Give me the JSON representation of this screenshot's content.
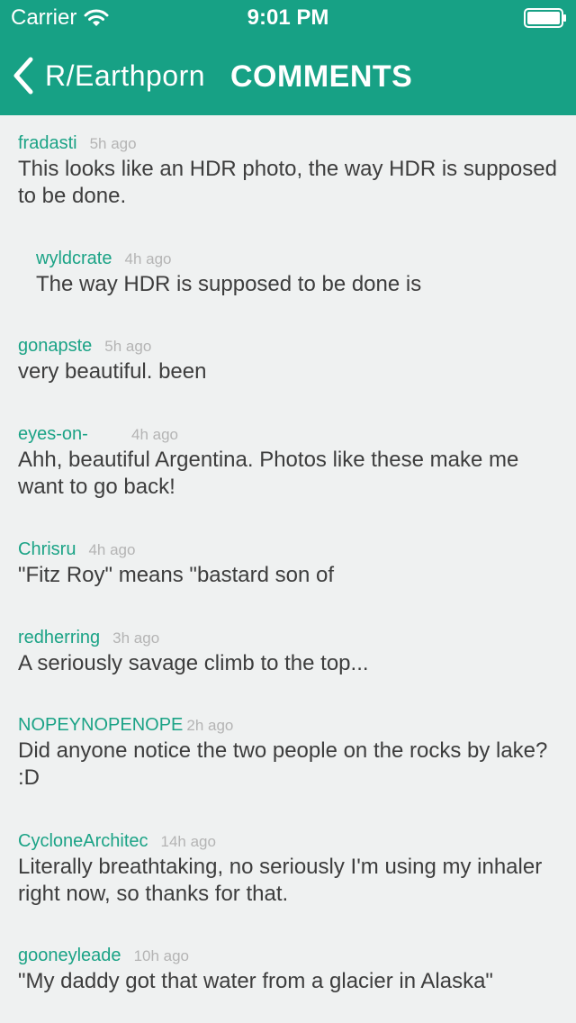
{
  "status": {
    "carrier": "Carrier",
    "time": "9:01 PM",
    "icons": [
      "wifi-icon",
      "battery-icon"
    ]
  },
  "nav": {
    "back_label": "R/Earthporn",
    "back_icon": "chevron-left-icon",
    "title": "COMMENTS"
  },
  "colors": {
    "header_bg": "#17a185",
    "author": "#1ba386",
    "timestamp": "#b4b4b4",
    "background": "#eff1f1"
  },
  "comments": [
    {
      "author": "fradasti",
      "time": "5h ago",
      "text": "This looks like an HDR photo, the way HDR is supposed to be done.",
      "reply": false
    },
    {
      "author": "wyldcrate",
      "time": "4h ago",
      "text": "The way HDR is supposed to be done is",
      "reply": true
    },
    {
      "author": "gonapste",
      "time": "5h ago",
      "text": "very beautiful. been",
      "reply": false
    },
    {
      "author": "eyes-on-",
      "time": "4h ago",
      "text": "Ahh, beautiful Argentina. Photos like these make me want to go back!",
      "reply": false
    },
    {
      "author": "Chrisru",
      "time": "4h ago",
      "text": "\"Fitz Roy\" means \"bastard son of",
      "reply": false
    },
    {
      "author": "redherring",
      "time": "3h ago",
      "text": "A seriously savage climb to the top...",
      "reply": false
    },
    {
      "author": "NOPEYNOPENOPE",
      "time": "2h ago",
      "text": "Did anyone notice the two people on the rocks by lake? :D",
      "reply": false
    },
    {
      "author": "CycloneArchitec",
      "time": "14h ago",
      "text": "Literally breathtaking, no seriously I'm using my inhaler right now, so thanks for that.",
      "reply": false
    },
    {
      "author": "gooneyleade",
      "time": "10h ago",
      "text": "\"My daddy got that water from a glacier in Alaska\"",
      "reply": false
    }
  ]
}
